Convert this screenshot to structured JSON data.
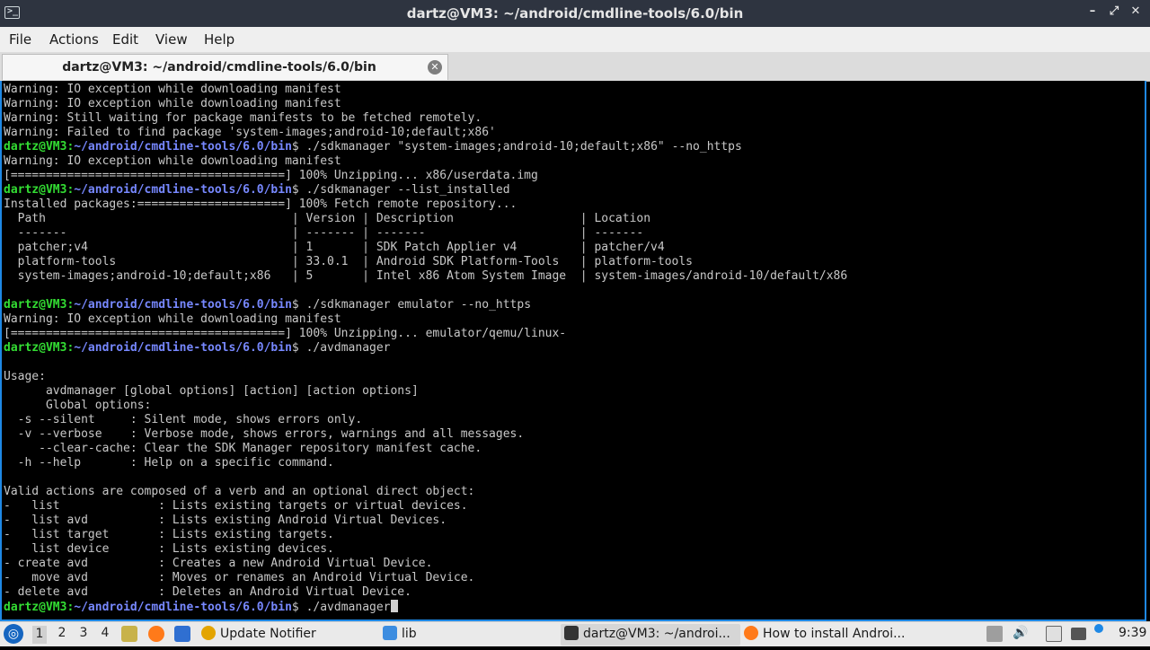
{
  "window": {
    "title": "dartz@VM3: ~/android/cmdline-tools/6.0/bin"
  },
  "menu": [
    "File",
    "Actions",
    "Edit",
    "View",
    "Help"
  ],
  "tab": {
    "title": "dartz@VM3: ~/android/cmdline-tools/6.0/bin"
  },
  "terminal": {
    "prompt_user": "dartz@VM3",
    "prompt_sep": ":",
    "prompt_path": "~/android/cmdline-tools/6.0/bin",
    "prompt_dollar": "$ ",
    "lines": [
      {
        "text": "Warning: IO exception while downloading manifest"
      },
      {
        "text": "Warning: IO exception while downloading manifest"
      },
      {
        "text": "Warning: Still waiting for package manifests to be fetched remotely."
      },
      {
        "text": "Warning: Failed to find package 'system-images;android-10;default;x86'"
      },
      {
        "prompt": true,
        "text": "./sdkmanager \"system-images;android-10;default;x86\" --no_https"
      },
      {
        "text": "Warning: IO exception while downloading manifest"
      },
      {
        "text": "[=======================================] 100% Unzipping... x86/userdata.img"
      },
      {
        "prompt": true,
        "text": "./sdkmanager --list_installed"
      },
      {
        "text": "Installed packages:=====================] 100% Fetch remote repository..."
      },
      {
        "text": "  Path                                   | Version | Description                  | Location"
      },
      {
        "text": "  -------                                | ------- | -------                      | -------"
      },
      {
        "text": "  patcher;v4                             | 1       | SDK Patch Applier v4         | patcher/v4"
      },
      {
        "text": "  platform-tools                         | 33.0.1  | Android SDK Platform-Tools   | platform-tools"
      },
      {
        "text": "  system-images;android-10;default;x86   | 5       | Intel x86 Atom System Image  | system-images/android-10/default/x86"
      },
      {
        "text": ""
      },
      {
        "prompt": true,
        "text": "./sdkmanager emulator --no_https"
      },
      {
        "text": "Warning: IO exception while downloading manifest"
      },
      {
        "text": "[=======================================] 100% Unzipping... emulator/qemu/linux-"
      },
      {
        "prompt": true,
        "text": "./avdmanager"
      },
      {
        "text": ""
      },
      {
        "text": "Usage:"
      },
      {
        "text": "      avdmanager [global options] [action] [action options]"
      },
      {
        "text": "      Global options:"
      },
      {
        "text": "  -s --silent     : Silent mode, shows errors only."
      },
      {
        "text": "  -v --verbose    : Verbose mode, shows errors, warnings and all messages."
      },
      {
        "text": "     --clear-cache: Clear the SDK Manager repository manifest cache."
      },
      {
        "text": "  -h --help       : Help on a specific command."
      },
      {
        "text": ""
      },
      {
        "text": "Valid actions are composed of a verb and an optional direct object:"
      },
      {
        "text": "-   list              : Lists existing targets or virtual devices."
      },
      {
        "text": "-   list avd          : Lists existing Android Virtual Devices."
      },
      {
        "text": "-   list target       : Lists existing targets."
      },
      {
        "text": "-   list device       : Lists existing devices."
      },
      {
        "text": "- create avd          : Creates a new Android Virtual Device."
      },
      {
        "text": "-   move avd          : Moves or renames an Android Virtual Device."
      },
      {
        "text": "- delete avd          : Deletes an Android Virtual Device."
      },
      {
        "prompt": true,
        "text": "./avdmanager",
        "cursor": true
      }
    ]
  },
  "taskbar": {
    "workspaces": [
      "1",
      "2",
      "3",
      "4"
    ],
    "active_workspace": "1",
    "quicklaunch": [
      {
        "icon": "notes-icon",
        "color": "#c8b24a"
      },
      {
        "icon": "firefox-icon",
        "color": "#ff7a1a"
      },
      {
        "icon": "desktop-icon",
        "color": "#2f6fd1"
      }
    ],
    "tasks": [
      {
        "icon": "update-notifier-icon",
        "label": "Update Notifier",
        "color": "#e3a400"
      },
      {
        "icon": "folder-icon",
        "label": "lib",
        "color": "#3d8de0"
      },
      {
        "icon": "terminal-icon",
        "label": "dartz@VM3: ~/androi...",
        "color": "#333333",
        "active": true
      },
      {
        "icon": "firefox-icon",
        "label": "How to install Androi...",
        "color": "#ff7a1a"
      }
    ],
    "clock": "9:39",
    "accent": "#1e88e5"
  }
}
